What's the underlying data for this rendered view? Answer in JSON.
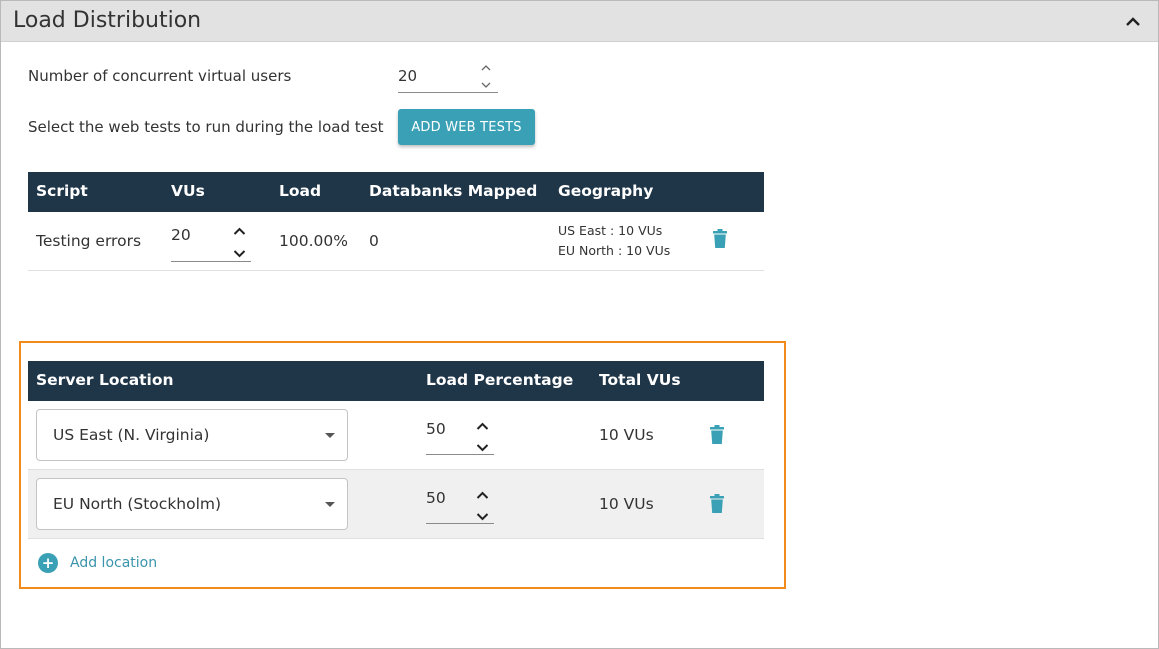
{
  "panel": {
    "title": "Load Distribution"
  },
  "settings": {
    "concurrent_users_label": "Number of concurrent virtual users",
    "concurrent_users_value": "20",
    "select_tests_label": "Select the web tests to run during the load test",
    "add_web_tests_label": "ADD WEB TESTS"
  },
  "scripts_table": {
    "headers": {
      "script": "Script",
      "vus": "VUs",
      "load": "Load",
      "databanks": "Databanks Mapped",
      "geography": "Geography"
    },
    "rows": [
      {
        "script": "Testing errors",
        "vus": "20",
        "load": "100.00%",
        "databanks": "0",
        "geography": [
          "US East : 10 VUs",
          "EU North : 10 VUs"
        ]
      }
    ]
  },
  "locations_table": {
    "headers": {
      "server_location": "Server Location",
      "load_percentage": "Load Percentage",
      "total_vus": "Total VUs"
    },
    "rows": [
      {
        "location": "US East (N. Virginia)",
        "load_percentage": "50",
        "total_vus": "10 VUs"
      },
      {
        "location": "EU North (Stockholm)",
        "load_percentage": "50",
        "total_vus": "10 VUs"
      }
    ],
    "add_location_label": "Add location"
  },
  "colors": {
    "header_bg": "#1f3548",
    "accent": "#3aa0b5",
    "highlight_border": "#f28a1d",
    "panel_header_bg": "#e2e2e2"
  },
  "icons": {
    "collapse": "chevron-up-icon",
    "delete": "trash-icon",
    "add": "plus-circle-icon",
    "spin_up": "chevron-up-icon",
    "spin_down": "chevron-down-icon",
    "dropdown": "caret-down-icon"
  }
}
